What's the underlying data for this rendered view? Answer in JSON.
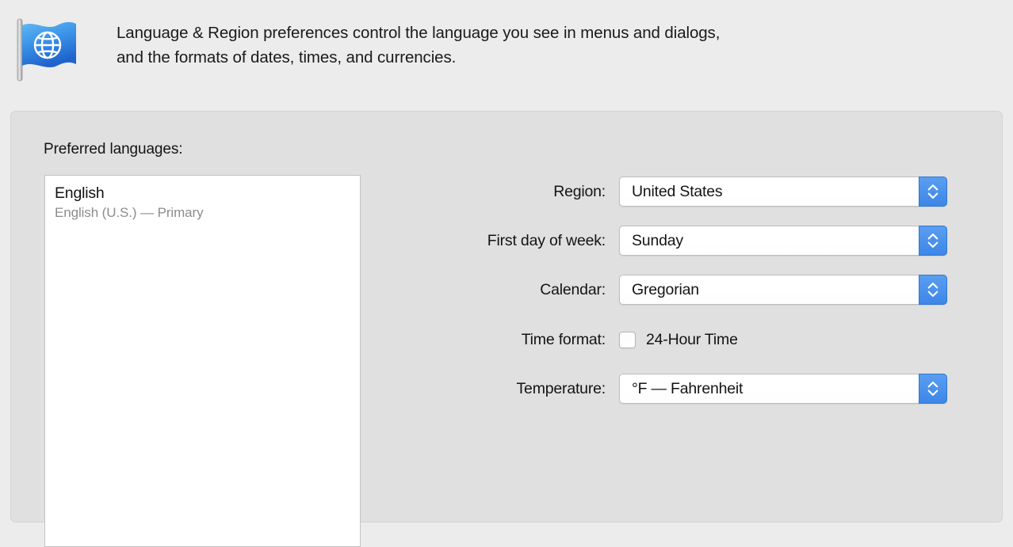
{
  "header": {
    "icon": "flag-globe-icon",
    "description_line1": "Language & Region preferences control the language you see in menus and dialogs,",
    "description_line2": "and the formats of dates, times, and currencies."
  },
  "panel": {
    "preferred_languages_label": "Preferred languages:",
    "language_list": [
      {
        "name": "English",
        "detail": "English (U.S.) — Primary"
      }
    ],
    "settings": [
      {
        "label": "Region:",
        "type": "popup",
        "value": "United States",
        "control_name": "region-popup"
      },
      {
        "label": "First day of week:",
        "type": "popup",
        "value": "Sunday",
        "control_name": "first-day-of-week-popup"
      },
      {
        "label": "Calendar:",
        "type": "popup",
        "value": "Gregorian",
        "control_name": "calendar-popup"
      },
      {
        "label": "Time format:",
        "type": "checkbox",
        "value": "24-Hour Time",
        "checked": false,
        "control_name": "24-hour-time-checkbox"
      },
      {
        "label": "Temperature:",
        "type": "popup",
        "value": "°F — Fahrenheit",
        "control_name": "temperature-popup"
      }
    ]
  },
  "colors": {
    "window_background": "#ececec",
    "panel_background": "#e0e0e0",
    "list_background": "#ffffff",
    "accent_blue": "#3d86e8",
    "label_text": "#141414",
    "secondary_text": "#8c8c8c"
  }
}
